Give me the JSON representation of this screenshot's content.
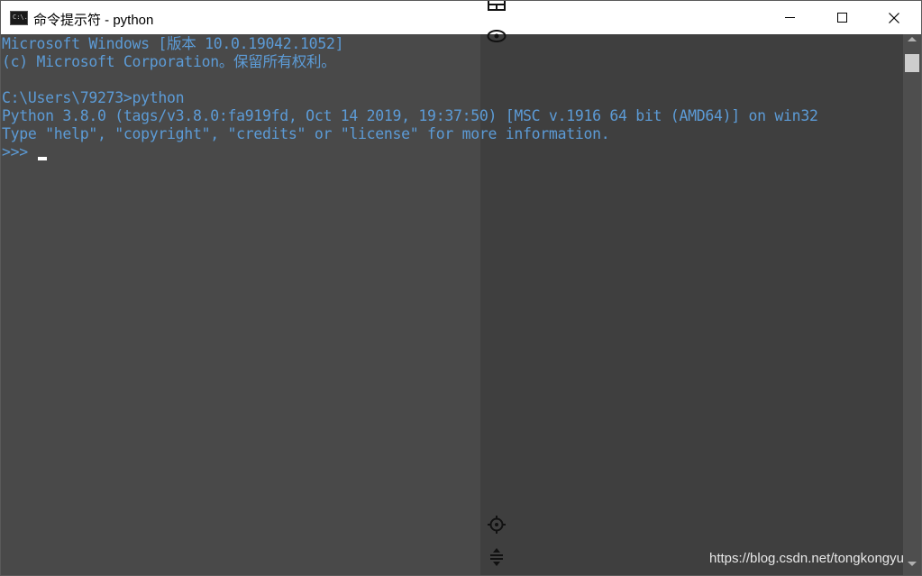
{
  "window": {
    "title": "命令提示符 - python",
    "icon": "cmd-icon",
    "icon_text": "C:\\."
  },
  "console": {
    "lines": [
      "Microsoft Windows [版本 10.0.19042.1052]",
      "(c) Microsoft Corporation。保留所有权利。",
      "",
      "C:\\Users\\79273>python",
      "Python 3.8.0 (tags/v3.8.0:fa919fd, Oct 14 2019, 19:37:50) [MSC v.1916 64 bit (AMD64)] on win32",
      "Type \"help\", \"copyright\", \"credits\" or \"license\" for more information.",
      ">>> "
    ],
    "text_color": "#5c9bd6",
    "background": "#494949"
  },
  "overlay_icons": [
    "save-icon",
    "eye-icon",
    "crosshair-icon",
    "move-icon"
  ],
  "watermark": "https://blog.csdn.net/tongkongyu"
}
